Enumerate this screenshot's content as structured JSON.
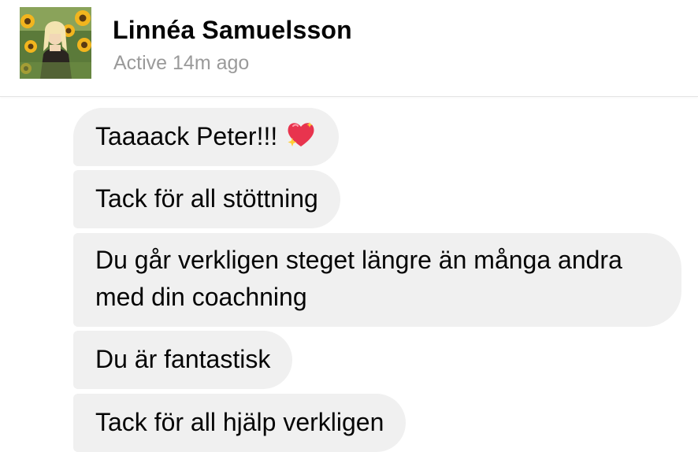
{
  "header": {
    "contact_name": "Linnéa Samuelsson",
    "status": "Active 14m ago",
    "avatar_icon": "profile-photo-sunflowers"
  },
  "messages": [
    {
      "text": "Taaaack Peter!!!",
      "emoji": "sparkling-heart-icon"
    },
    {
      "text": "Tack för all stöttning"
    },
    {
      "text": "Du går verkligen steget längre än många andra med din coachning"
    },
    {
      "text": "Du är fantastisk"
    },
    {
      "text": "Tack för all hjälp verkligen"
    }
  ],
  "colors": {
    "bubble_bg": "#f0f0f0",
    "status_text": "#9a9a9a",
    "heart": "#e8344e",
    "sparkle": "#ffcc33"
  }
}
